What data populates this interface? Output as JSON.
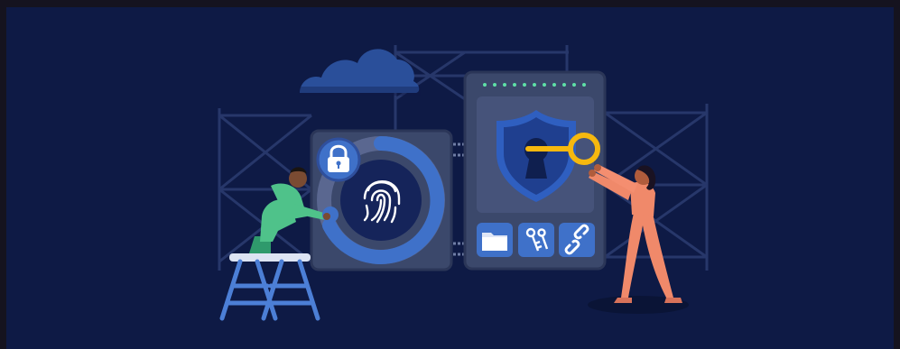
{
  "scene": {
    "subject": "cybersecurity-illustration",
    "palette": {
      "frame": "#15131f",
      "background": "#0e1a45",
      "scaffold": "#2a3a6a",
      "panel": "#3d4a6e",
      "panel_inner": "#4b5879",
      "accent_blue": "#3f71c9",
      "shield_blue": "#2f5fc0",
      "key_yellow": "#f6b80e",
      "led_green": "#5fe0a6",
      "worker_green": "#4fc28a",
      "woman_coral": "#f0896a",
      "ladder_blue": "#4c7fd6"
    },
    "icons": [
      "cloud-icon",
      "padlock-icon",
      "fingerprint-icon",
      "shield-keyhole-icon",
      "key-icon",
      "folder-icon",
      "keys-icon",
      "link-icon"
    ]
  }
}
